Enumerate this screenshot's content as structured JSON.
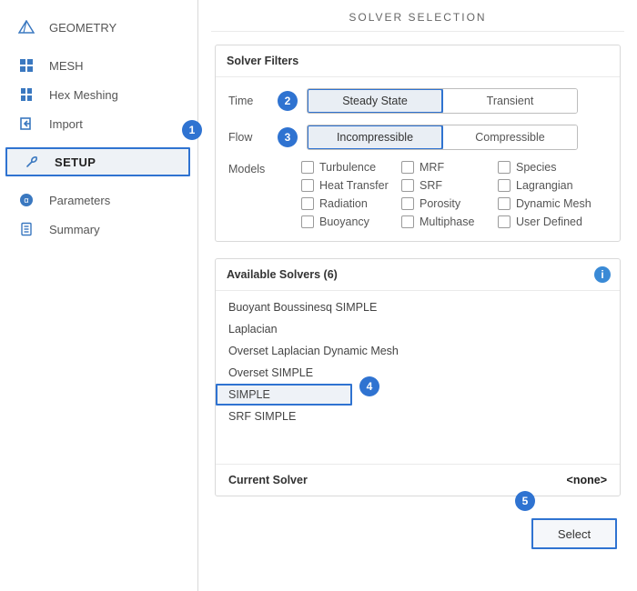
{
  "sidebar": {
    "items": [
      {
        "label": "GEOMETRY",
        "icon": "pyramid-icon"
      },
      {
        "label": "MESH",
        "icon": "grid-icon"
      },
      {
        "label": "Hex Meshing",
        "icon": "hex-icon"
      },
      {
        "label": "Import",
        "icon": "import-icon"
      },
      {
        "label": "SETUP",
        "icon": "wrench-icon"
      },
      {
        "label": "Parameters",
        "icon": "params-icon"
      },
      {
        "label": "Summary",
        "icon": "doc-icon"
      }
    ]
  },
  "main": {
    "title": "SOLVER SELECTION",
    "filters": {
      "header": "Solver Filters",
      "time_label": "Time",
      "time_options": [
        "Steady State",
        "Transient"
      ],
      "flow_label": "Flow",
      "flow_options": [
        "Incompressible",
        "Compressible"
      ],
      "models_label": "Models",
      "models": {
        "col1": [
          "Turbulence",
          "Heat Transfer",
          "Radiation",
          "Buoyancy"
        ],
        "col2": [
          "MRF",
          "SRF",
          "Porosity",
          "Multiphase"
        ],
        "col3": [
          "Species",
          "Lagrangian",
          "Dynamic Mesh",
          "User Defined"
        ]
      }
    },
    "solvers": {
      "header": "Available Solvers (6)",
      "items": [
        "Buoyant Boussinesq SIMPLE",
        "Laplacian",
        "Overset Laplacian Dynamic Mesh",
        "Overset SIMPLE",
        "SIMPLE",
        "SRF SIMPLE"
      ],
      "selected_index": 4,
      "current_label": "Current Solver",
      "current_value": "<none>"
    },
    "select_button": "Select"
  },
  "callouts": [
    "1",
    "2",
    "3",
    "4",
    "5"
  ]
}
